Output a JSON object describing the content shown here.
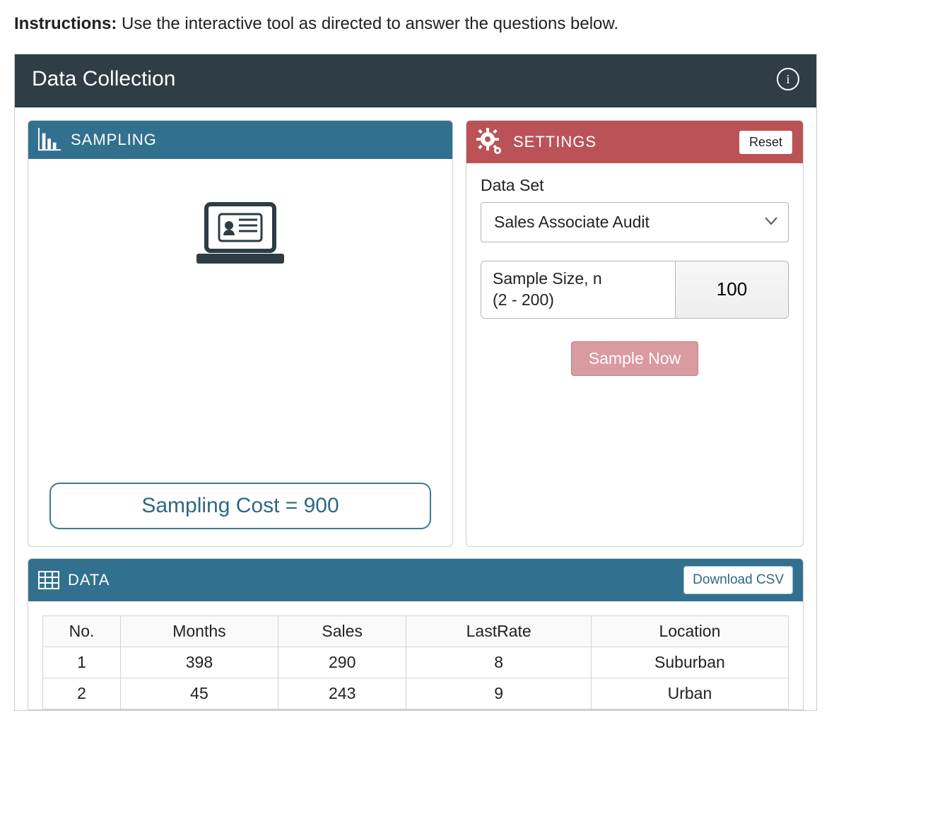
{
  "instructions": {
    "label": "Instructions:",
    "text": "Use the interactive tool as directed to answer the questions below."
  },
  "app": {
    "title": "Data Collection"
  },
  "sampling": {
    "header": "SAMPLING",
    "cost_label": "Sampling Cost = ",
    "cost_value": "900"
  },
  "settings": {
    "header": "SETTINGS",
    "reset_label": "Reset",
    "dataset_label": "Data Set",
    "dataset_selected": "Sales Associate Audit",
    "sample_size_label_line1": "Sample Size, n",
    "sample_size_label_line2": "(2 - 200)",
    "sample_size_value": "100",
    "sample_now_label": "Sample Now"
  },
  "data": {
    "header": "DATA",
    "download_label": "Download CSV",
    "columns": [
      "No.",
      "Months",
      "Sales",
      "LastRate",
      "Location"
    ],
    "rows": [
      [
        "1",
        "398",
        "290",
        "8",
        "Suburban"
      ],
      [
        "2",
        "45",
        "243",
        "9",
        "Urban"
      ]
    ]
  }
}
